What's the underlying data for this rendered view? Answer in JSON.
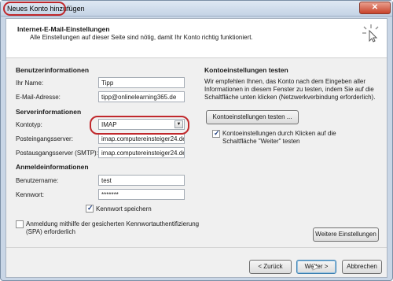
{
  "window": {
    "title": "Neues Konto hinzufügen",
    "close_glyph": "✕"
  },
  "header": {
    "title": "Internet-E-Mail-Einstellungen",
    "subtitle": "Alle Einstellungen auf dieser Seite sind nötig, damit Ihr Konto richtig funktioniert."
  },
  "user_info": {
    "heading": "Benutzerinformationen",
    "name_label": "Ihr Name:",
    "name_value": "Tipp",
    "email_label": "E-Mail-Adresse:",
    "email_value": "tipp@onlinelearning365.de"
  },
  "server_info": {
    "heading": "Serverinformationen",
    "account_type_label": "Kontotyp:",
    "account_type_value": "IMAP",
    "incoming_label": "Posteingangsserver:",
    "incoming_value": "imap.computereinsteiger24.de",
    "outgoing_label": "Postausgangsserver (SMTP):",
    "outgoing_value": "imap.computereinsteiger24.de"
  },
  "login_info": {
    "heading": "Anmeldeinformationen",
    "username_label": "Benutzername:",
    "username_value": "test",
    "password_label": "Kennwort:",
    "password_value": "*******",
    "remember_password_label": "Kennwort speichern",
    "remember_password_checked": true,
    "spa_label_line1": "Anmeldung mithilfe der gesicherten Kennwortauthentifizierung",
    "spa_label_line2": "(SPA) erforderlich",
    "spa_checked": false
  },
  "test_settings": {
    "heading": "Kontoeinstellungen testen",
    "description_line1": "Wir empfehlen Ihnen, das Konto nach dem Eingeben aller",
    "description_line2": "Informationen in diesem Fenster zu testen, indem Sie auf die",
    "description_line3": "Schaltfläche unten klicken (Netzwerkverbindung erforderlich).",
    "test_button": "Kontoeinstellungen testen ...",
    "auto_test_line1": "Kontoeinstellungen durch Klicken auf die",
    "auto_test_line2": "Schaltfläche \"Weiter\" testen",
    "auto_test_checked": true,
    "more_settings_button": "Weitere Einstellungen"
  },
  "footer": {
    "back_button": "< Zurück",
    "next_button": "Weiter >",
    "cancel_button": "Abbrechen"
  },
  "colors": {
    "highlight": "#c0282c",
    "accent": "#3c7fb1"
  }
}
